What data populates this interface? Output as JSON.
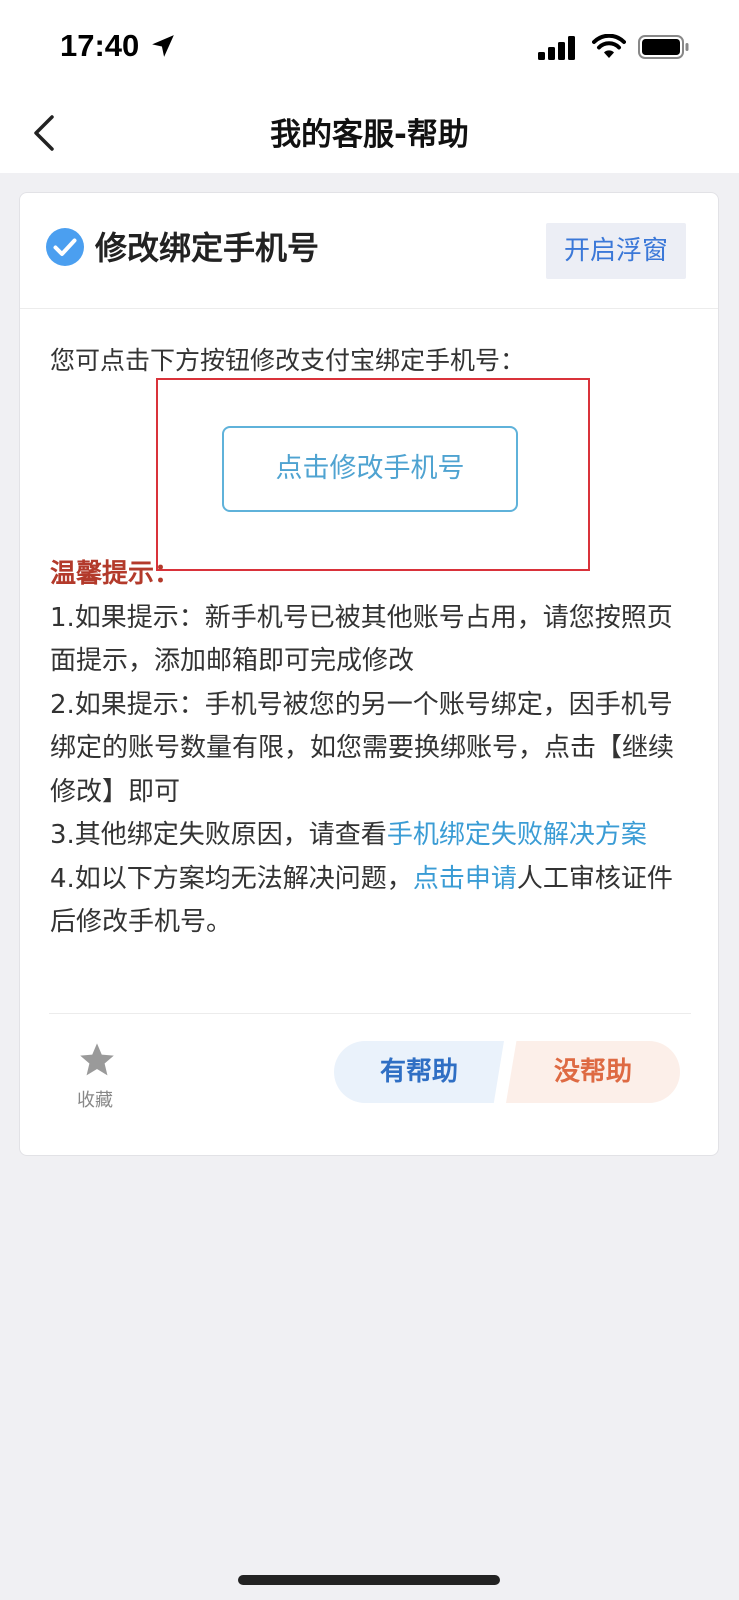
{
  "status": {
    "time": "17:40"
  },
  "nav": {
    "title": "我的客服-帮助"
  },
  "card": {
    "title": "修改绑定手机号",
    "float_button": "开启浮窗",
    "intro": "您可点击下方按钮修改支付宝绑定手机号：",
    "modify_button": "点击修改手机号",
    "tips_title": "温馨提示：",
    "tip1": "1.如果提示：新手机号已被其他账号占用，请您按照页面提示，添加邮箱即可完成修改",
    "tip2": "2.如果提示：手机号被您的另一个账号绑定，因手机号绑定的账号数量有限，如您需要换绑账号，点击【继续修改】即可",
    "tip3_prefix": "3.其他绑定失败原因，请查看",
    "tip3_link": "手机绑定失败解决方案",
    "tip4_prefix": "4.如以下方案均无法解决问题，",
    "tip4_link": "点击申请",
    "tip4_suffix": "人工审核证件后修改手机号。",
    "collect_label": "收藏",
    "helpful": "有帮助",
    "not_helpful": "没帮助"
  },
  "colors": {
    "accent_blue": "#3a9cd5",
    "tips_title_red": "#b33a2b",
    "highlight_red": "#d9323a",
    "not_helpful_orange": "#de6a43"
  },
  "icons": [
    "location-arrow-icon",
    "signal-icon",
    "wifi-icon",
    "battery-icon",
    "back-arrow-icon",
    "check-circle-icon",
    "star-icon"
  ]
}
